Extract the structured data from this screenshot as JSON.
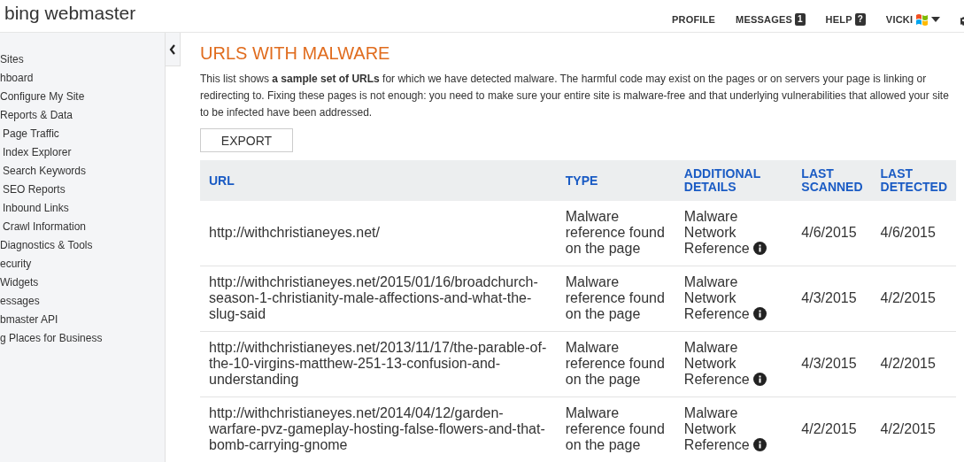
{
  "header": {
    "logo": "bing webmaster",
    "nav": [
      {
        "label": "PROFILE",
        "kind": "link"
      },
      {
        "label": "MESSAGES",
        "kind": "count",
        "badge": "1"
      },
      {
        "label": "HELP",
        "kind": "count",
        "badge": "?"
      },
      {
        "label": "VICKI",
        "kind": "user"
      }
    ]
  },
  "sidebar": {
    "items": [
      {
        "label": "Sites"
      },
      {
        "label": "hboard"
      },
      {
        "label": "Configure My Site"
      },
      {
        "label": "Reports & Data",
        "children": [
          {
            "label": "Page Traffic"
          },
          {
            "label": "Index Explorer"
          },
          {
            "label": "Search Keywords"
          },
          {
            "label": "SEO Reports"
          },
          {
            "label": "Inbound Links"
          },
          {
            "label": "Crawl Information"
          }
        ]
      },
      {
        "label": "Diagnostics & Tools"
      },
      {
        "label": "ecurity"
      },
      {
        "label": "Widgets"
      },
      {
        "label": "essages"
      },
      {
        "label": "bmaster API"
      },
      {
        "label": "g Places for Business"
      }
    ]
  },
  "main": {
    "title": "URLS WITH MALWARE",
    "description": "This list shows **a sample set of URLs** for which we have detected malware. The harmful code may exist on the pages or on servers your page is linking or redirecting to. Fixing these pages is not enough: you need to make sure your entire site is malware-free and that underlying vulnerabilities that allowed your site to be infected have been addressed.",
    "export_button": "EXPORT",
    "table": {
      "columns": [
        "URL",
        "TYPE",
        "ADDITIONAL DETAILS",
        "LAST SCANNED",
        "LAST DETECTED"
      ],
      "rows": [
        [
          "http://withchristianeyes.net/",
          "Malware reference found on the page",
          "Malware Network Reference",
          "4/6/2015",
          "4/6/2015"
        ],
        [
          "http://withchristianeyes.net/2015/01/16/broadchurch-season-1-christianity-male-affections-and-what-the-slug-said",
          "Malware reference found on the page",
          "Malware Network Reference",
          "4/3/2015",
          "4/2/2015"
        ],
        [
          "http://withchristianeyes.net/2013/11/17/the-parable-of-the-10-virgins-matthew-251-13-confusion-and-understanding",
          "Malware reference found on the page",
          "Malware Network Reference",
          "4/3/2015",
          "4/2/2015"
        ],
        [
          "http://withchristianeyes.net/2014/04/12/garden-warfare-pvz-gameplay-hosting-false-flowers-and-that-bomb-carrying-gnome",
          "Malware reference found on the page",
          "Malware Network Reference",
          "4/2/2015",
          "4/2/2015"
        ]
      ]
    }
  }
}
